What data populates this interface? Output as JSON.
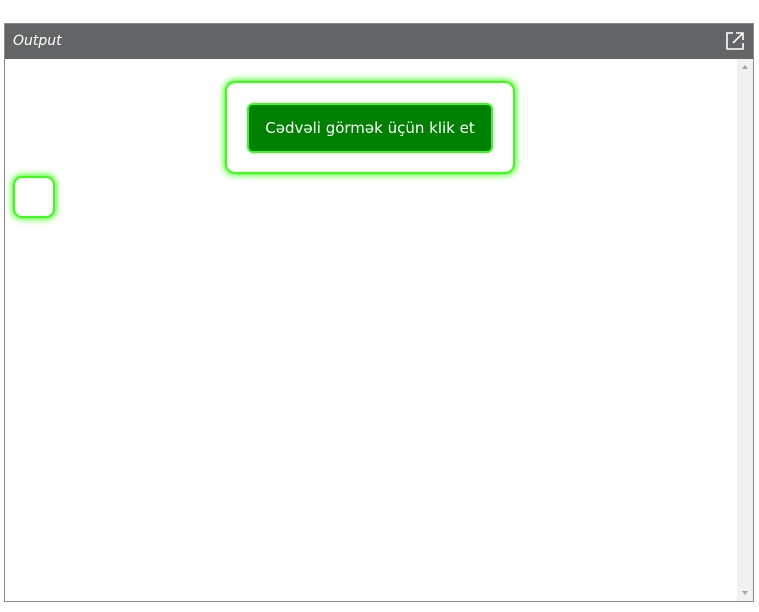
{
  "panel": {
    "title": "Output",
    "popout_icon": "external-link-icon"
  },
  "content": {
    "primary_button_label": "Cədvəli görmək üçün klik et"
  },
  "colors": {
    "header_bg": "#636466",
    "button_bg": "#008000",
    "glow": "#39ff14"
  }
}
